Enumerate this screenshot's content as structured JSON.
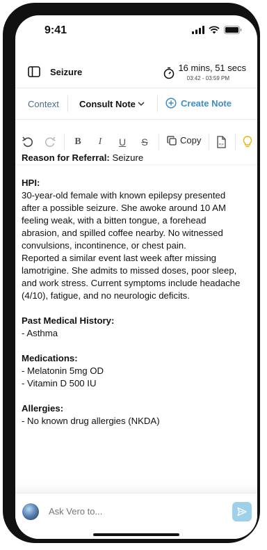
{
  "status_bar": {
    "time": "9:41"
  },
  "header": {
    "title": "Seizure",
    "timer_duration": "16 mins, 51 secs",
    "timer_range": "03:42 - 03:59 PM"
  },
  "tabs": {
    "context": "Context",
    "consult_note": "Consult Note",
    "create_note": "Create Note"
  },
  "toolbar": {
    "copy_label": "Copy"
  },
  "note": {
    "reason_label": "Reason for Referral:",
    "reason_value": " Seizure",
    "hpi_heading": "HPI:",
    "hpi_p1_lines": [
      "30-year-old female with known epilepsy presented",
      "after a possible seizure. She awoke around 10 AM",
      "feeling weak, with a bitten tongue, a forehead",
      "abrasion, and spilled coffee nearby. No witnessed",
      "convulsions, incontinence, or chest pain."
    ],
    "hpi_p2_lines": [
      "Reported a similar event last week after missing",
      "lamotrigine. She admits to missed doses, poor sleep,",
      "and work stress. Current symptoms include headache",
      "(4/10), fatigue, and no neurologic deficits."
    ],
    "pmh_heading": "Past Medical History:",
    "pmh_items": [
      "- Asthma"
    ],
    "meds_heading": "Medications:",
    "meds_items": [
      "- Melatonin 5mg OD",
      "- Vitamin D 500 IU"
    ],
    "allergies_heading": "Allergies:",
    "allergies_items": [
      "- No known drug allergies (NKDA)"
    ]
  },
  "chat": {
    "placeholder": "Ask Vero to..."
  },
  "colors": {
    "accent": "#3a8fc8",
    "send_button": "#9fd0ea",
    "context_tab": "#4a6b8a",
    "lightbulb": "#e8b20e"
  }
}
